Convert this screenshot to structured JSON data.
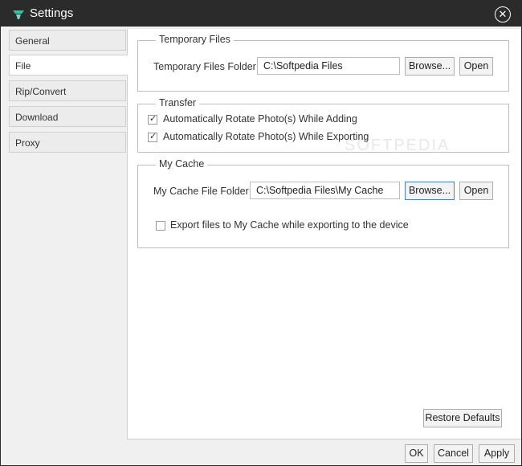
{
  "window": {
    "title": "Settings"
  },
  "sidebar": {
    "items": [
      {
        "label": "General"
      },
      {
        "label": "File"
      },
      {
        "label": "Rip/Convert"
      },
      {
        "label": "Download"
      },
      {
        "label": "Proxy"
      }
    ],
    "selected": "File"
  },
  "temporary_files": {
    "title": "Temporary Files",
    "folder_label": "Temporary Files Folder:",
    "folder_value": "C:\\Softpedia Files",
    "browse_label": "Browse...",
    "open_label": "Open"
  },
  "transfer": {
    "title": "Transfer",
    "options": [
      {
        "label": "Automatically Rotate Photo(s) While Adding",
        "checked": true
      },
      {
        "label": "Automatically Rotate Photo(s) While Exporting",
        "checked": true
      }
    ]
  },
  "my_cache": {
    "title": "My Cache",
    "folder_label": "My Cache File Folder:",
    "folder_value": "C:\\Softpedia Files\\My Cache",
    "browse_label": "Browse...",
    "open_label": "Open",
    "export_label": "Export files to My Cache while exporting to the device",
    "export_checked": false
  },
  "buttons": {
    "restore_defaults": "Restore Defaults",
    "ok": "OK",
    "cancel": "Cancel",
    "apply": "Apply"
  },
  "watermark": "SOFTPEDIA"
}
